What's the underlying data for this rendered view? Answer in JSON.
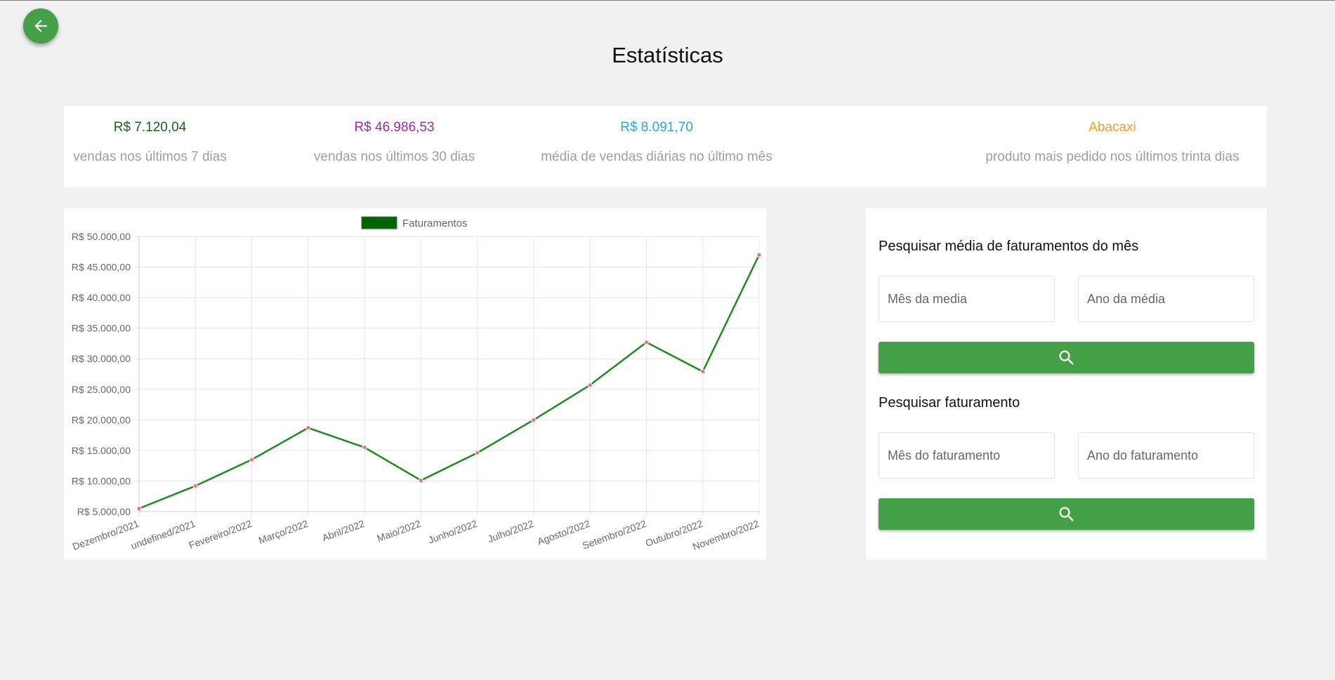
{
  "header": {
    "title": "Estatísticas"
  },
  "stats": [
    {
      "value": "R$ 7.120,04",
      "label": "vendas nos últimos 7 dias",
      "color": "#1b5e20"
    },
    {
      "value": "R$ 46.986,53",
      "label": "vendas nos últimos 30 dias",
      "color": "#9c27b0"
    },
    {
      "value": "R$ 8.091,70",
      "label": "média de vendas diárias no último mês",
      "color": "#29a8e0"
    },
    {
      "value": "Abacaxi",
      "label": "produto mais pedido nos últimos trinta dias",
      "color": "#f0a020"
    }
  ],
  "search": {
    "average_title": "Pesquisar média de faturamentos do mês",
    "average_month_placeholder": "Mês da media",
    "average_year_placeholder": "Ano da média",
    "revenue_title": "Pesquisar faturamento",
    "revenue_month_placeholder": "Mês do faturamento",
    "revenue_year_placeholder": "Ano do faturamento"
  },
  "colors": {
    "accent": "#43a047",
    "line": "#1e8a1e",
    "legend_box": "#006400",
    "point": "#ff6384"
  },
  "chart_data": {
    "type": "line",
    "categories": [
      "Dezembro/2021",
      "undefined/2021",
      "Fevereiro/2022",
      "Março/2022",
      "Abril/2022",
      "Maio/2022",
      "Junho/2022",
      "Julho/2022",
      "Agosto/2022",
      "Setembro/2022",
      "Outubro/2022",
      "Novembro/2022"
    ],
    "series": [
      {
        "name": "Faturamentos",
        "values": [
          5500,
          9200,
          13500,
          18700,
          15500,
          10100,
          14600,
          20000,
          25700,
          32700,
          27900,
          47000
        ]
      }
    ],
    "ylim": [
      5000,
      50000
    ],
    "yticks": [
      {
        "value": 50000,
        "label": "R$ 50.000,00"
      },
      {
        "value": 45000,
        "label": "R$ 45.000,00"
      },
      {
        "value": 40000,
        "label": "R$ 40.000,00"
      },
      {
        "value": 35000,
        "label": "R$ 35.000,00"
      },
      {
        "value": 30000,
        "label": "R$ 30.000,00"
      },
      {
        "value": 25000,
        "label": "R$ 25.000,00"
      },
      {
        "value": 20000,
        "label": "R$ 20.000,00"
      },
      {
        "value": 15000,
        "label": "R$ 15.000,00"
      },
      {
        "value": 10000,
        "label": "R$ 10.000,00"
      },
      {
        "value": 5000,
        "label": "R$ 5.000,00"
      }
    ],
    "grid": true,
    "legend": "top-center"
  }
}
